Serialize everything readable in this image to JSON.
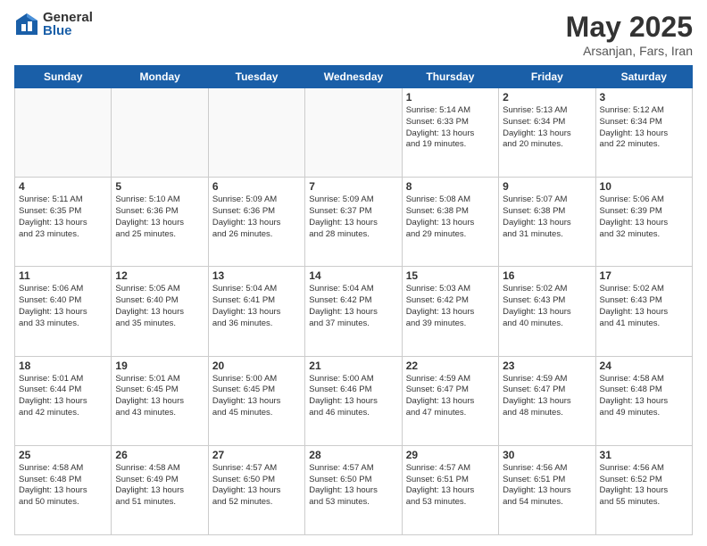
{
  "logo": {
    "general": "General",
    "blue": "Blue"
  },
  "title": "May 2025",
  "location": "Arsanjan, Fars, Iran",
  "days_of_week": [
    "Sunday",
    "Monday",
    "Tuesday",
    "Wednesday",
    "Thursday",
    "Friday",
    "Saturday"
  ],
  "weeks": [
    [
      {
        "day": "",
        "info": "",
        "empty": true
      },
      {
        "day": "",
        "info": "",
        "empty": true
      },
      {
        "day": "",
        "info": "",
        "empty": true
      },
      {
        "day": "",
        "info": "",
        "empty": true
      },
      {
        "day": "1",
        "info": "Sunrise: 5:14 AM\nSunset: 6:33 PM\nDaylight: 13 hours\nand 19 minutes."
      },
      {
        "day": "2",
        "info": "Sunrise: 5:13 AM\nSunset: 6:34 PM\nDaylight: 13 hours\nand 20 minutes."
      },
      {
        "day": "3",
        "info": "Sunrise: 5:12 AM\nSunset: 6:34 PM\nDaylight: 13 hours\nand 22 minutes."
      }
    ],
    [
      {
        "day": "4",
        "info": "Sunrise: 5:11 AM\nSunset: 6:35 PM\nDaylight: 13 hours\nand 23 minutes."
      },
      {
        "day": "5",
        "info": "Sunrise: 5:10 AM\nSunset: 6:36 PM\nDaylight: 13 hours\nand 25 minutes."
      },
      {
        "day": "6",
        "info": "Sunrise: 5:09 AM\nSunset: 6:36 PM\nDaylight: 13 hours\nand 26 minutes."
      },
      {
        "day": "7",
        "info": "Sunrise: 5:09 AM\nSunset: 6:37 PM\nDaylight: 13 hours\nand 28 minutes."
      },
      {
        "day": "8",
        "info": "Sunrise: 5:08 AM\nSunset: 6:38 PM\nDaylight: 13 hours\nand 29 minutes."
      },
      {
        "day": "9",
        "info": "Sunrise: 5:07 AM\nSunset: 6:38 PM\nDaylight: 13 hours\nand 31 minutes."
      },
      {
        "day": "10",
        "info": "Sunrise: 5:06 AM\nSunset: 6:39 PM\nDaylight: 13 hours\nand 32 minutes."
      }
    ],
    [
      {
        "day": "11",
        "info": "Sunrise: 5:06 AM\nSunset: 6:40 PM\nDaylight: 13 hours\nand 33 minutes."
      },
      {
        "day": "12",
        "info": "Sunrise: 5:05 AM\nSunset: 6:40 PM\nDaylight: 13 hours\nand 35 minutes."
      },
      {
        "day": "13",
        "info": "Sunrise: 5:04 AM\nSunset: 6:41 PM\nDaylight: 13 hours\nand 36 minutes."
      },
      {
        "day": "14",
        "info": "Sunrise: 5:04 AM\nSunset: 6:42 PM\nDaylight: 13 hours\nand 37 minutes."
      },
      {
        "day": "15",
        "info": "Sunrise: 5:03 AM\nSunset: 6:42 PM\nDaylight: 13 hours\nand 39 minutes."
      },
      {
        "day": "16",
        "info": "Sunrise: 5:02 AM\nSunset: 6:43 PM\nDaylight: 13 hours\nand 40 minutes."
      },
      {
        "day": "17",
        "info": "Sunrise: 5:02 AM\nSunset: 6:43 PM\nDaylight: 13 hours\nand 41 minutes."
      }
    ],
    [
      {
        "day": "18",
        "info": "Sunrise: 5:01 AM\nSunset: 6:44 PM\nDaylight: 13 hours\nand 42 minutes."
      },
      {
        "day": "19",
        "info": "Sunrise: 5:01 AM\nSunset: 6:45 PM\nDaylight: 13 hours\nand 43 minutes."
      },
      {
        "day": "20",
        "info": "Sunrise: 5:00 AM\nSunset: 6:45 PM\nDaylight: 13 hours\nand 45 minutes."
      },
      {
        "day": "21",
        "info": "Sunrise: 5:00 AM\nSunset: 6:46 PM\nDaylight: 13 hours\nand 46 minutes."
      },
      {
        "day": "22",
        "info": "Sunrise: 4:59 AM\nSunset: 6:47 PM\nDaylight: 13 hours\nand 47 minutes."
      },
      {
        "day": "23",
        "info": "Sunrise: 4:59 AM\nSunset: 6:47 PM\nDaylight: 13 hours\nand 48 minutes."
      },
      {
        "day": "24",
        "info": "Sunrise: 4:58 AM\nSunset: 6:48 PM\nDaylight: 13 hours\nand 49 minutes."
      }
    ],
    [
      {
        "day": "25",
        "info": "Sunrise: 4:58 AM\nSunset: 6:48 PM\nDaylight: 13 hours\nand 50 minutes."
      },
      {
        "day": "26",
        "info": "Sunrise: 4:58 AM\nSunset: 6:49 PM\nDaylight: 13 hours\nand 51 minutes."
      },
      {
        "day": "27",
        "info": "Sunrise: 4:57 AM\nSunset: 6:50 PM\nDaylight: 13 hours\nand 52 minutes."
      },
      {
        "day": "28",
        "info": "Sunrise: 4:57 AM\nSunset: 6:50 PM\nDaylight: 13 hours\nand 53 minutes."
      },
      {
        "day": "29",
        "info": "Sunrise: 4:57 AM\nSunset: 6:51 PM\nDaylight: 13 hours\nand 53 minutes."
      },
      {
        "day": "30",
        "info": "Sunrise: 4:56 AM\nSunset: 6:51 PM\nDaylight: 13 hours\nand 54 minutes."
      },
      {
        "day": "31",
        "info": "Sunrise: 4:56 AM\nSunset: 6:52 PM\nDaylight: 13 hours\nand 55 minutes."
      }
    ]
  ]
}
